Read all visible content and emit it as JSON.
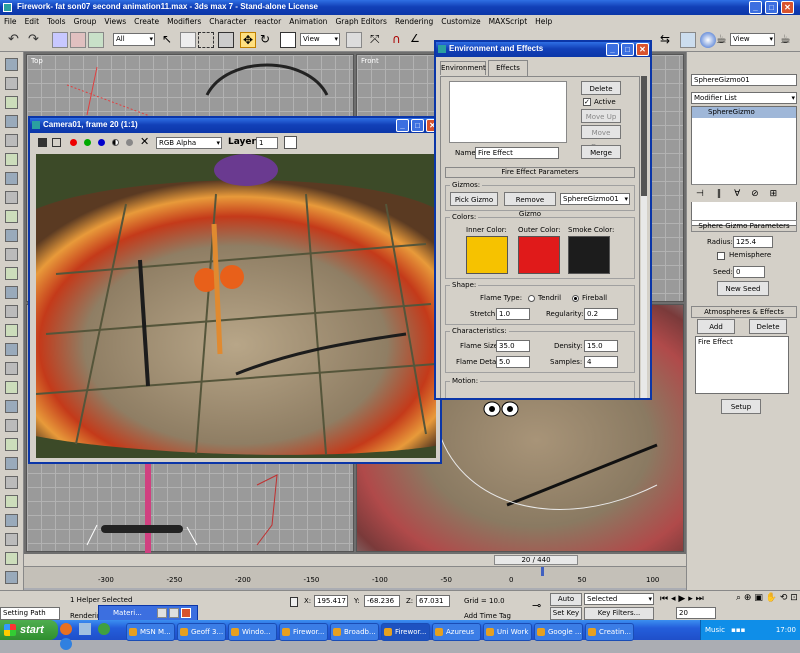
{
  "window": {
    "title": "Firework-  fat son07 second animation11.max - 3ds max 7  - Stand-alone License"
  },
  "menu": [
    "File",
    "Edit",
    "Tools",
    "Group",
    "Views",
    "Create",
    "Modifiers",
    "Character",
    "reactor",
    "Animation",
    "Graph Editors",
    "Rendering",
    "Customize",
    "MAXScript",
    "Help"
  ],
  "toolbar": {
    "selection_filter": "All",
    "ref_coord": "View",
    "ref_coord_right": "View"
  },
  "viewports": {
    "top_label": "Top",
    "front_label": "Front"
  },
  "camera_window": {
    "title": "Camera01, frame 20 (1:1)",
    "channel": "RGB Alpha",
    "layer_label": "Layer:",
    "layer_value": "1"
  },
  "env_dialog": {
    "title": "Environment and Effects",
    "tabs": [
      "Environment",
      "Effects"
    ],
    "delete_btn": "Delete",
    "active_label": "Active",
    "move_up": "Move Up",
    "move_down": "Move Down",
    "name_label": "Name:",
    "name_value": "Fire Effect",
    "merge_btn": "Merge",
    "section_title": "Fire Effect Parameters",
    "gizmos_label": "Gizmos:",
    "pick_gizmo": "Pick Gizmo",
    "remove_gizmo": "Remove Gizmo",
    "gizmo_select": "SphereGizmo01",
    "colors_label": "Colors:",
    "inner_color_label": "Inner Color:",
    "outer_color_label": "Outer Color:",
    "smoke_color_label": "Smoke Color:",
    "inner_color": "#f6c200",
    "outer_color": "#e01a1a",
    "smoke_color": "#1c1c1c",
    "shape_label": "Shape:",
    "flame_type_label": "Flame Type:",
    "tendril": "Tendril",
    "fireball": "Fireball",
    "stretch_label": "Stretch:",
    "stretch_value": "1.0",
    "regularity_label": "Regularity:",
    "regularity_value": "0.2",
    "characteristics_label": "Characteristics:",
    "flame_size_label": "Flame Size:",
    "flame_size_value": "35.0",
    "density_label": "Density:",
    "density_value": "15.0",
    "flame_detail_label": "Flame Detail:",
    "flame_detail_value": "5.0",
    "samples_label": "Samples:",
    "samples_value": "4",
    "motion_label": "Motion:"
  },
  "command_panel": {
    "object_name": "SphereGizmo01",
    "modifier_list": "Modifier List",
    "stack_item": "SphereGizmo",
    "params_title": "Sphere Gizmo Parameters",
    "radius_label": "Radius:",
    "radius_value": "125.4",
    "hemisphere_label": "Hemisphere",
    "seed_label": "Seed:",
    "seed_value": "0",
    "new_seed": "New Seed",
    "atmos_title": "Atmospheres & Effects",
    "add_btn": "Add",
    "delete_btn": "Delete",
    "effect_item": "Fire Effect",
    "setup_btn": "Setup"
  },
  "timeline": {
    "frame_label": "20 / 440",
    "ticks": [
      "-300",
      "-250",
      "-200",
      "-150",
      "-100",
      "-50",
      "0",
      "50",
      "100"
    ]
  },
  "status": {
    "left_field": "Setting Path",
    "selection": "1 Helper Selected",
    "rendering": "Rendering",
    "material_window": "Materi...",
    "x_label": "X:",
    "x_value": "195.417",
    "y_label": "Y:",
    "y_value": "-68.236",
    "z_label": "Z:",
    "z_value": "67.031",
    "grid": "Grid = 10.0",
    "add_time_tag": "Add Time Tag",
    "auto_key": "Auto Key",
    "selected": "Selected",
    "set_key": "Set Key",
    "key_filters": "Key Filters...",
    "frame_value": "20"
  },
  "taskbar": {
    "start": "start",
    "items": [
      "MSN M...",
      "Geoff 3...",
      "Windo...",
      "Firewor...",
      "Broadb...",
      "Firewor...",
      "Azureus",
      "Uni Work",
      "Google ...",
      "Creatin..."
    ],
    "music": "Music",
    "clock": "17:00"
  }
}
